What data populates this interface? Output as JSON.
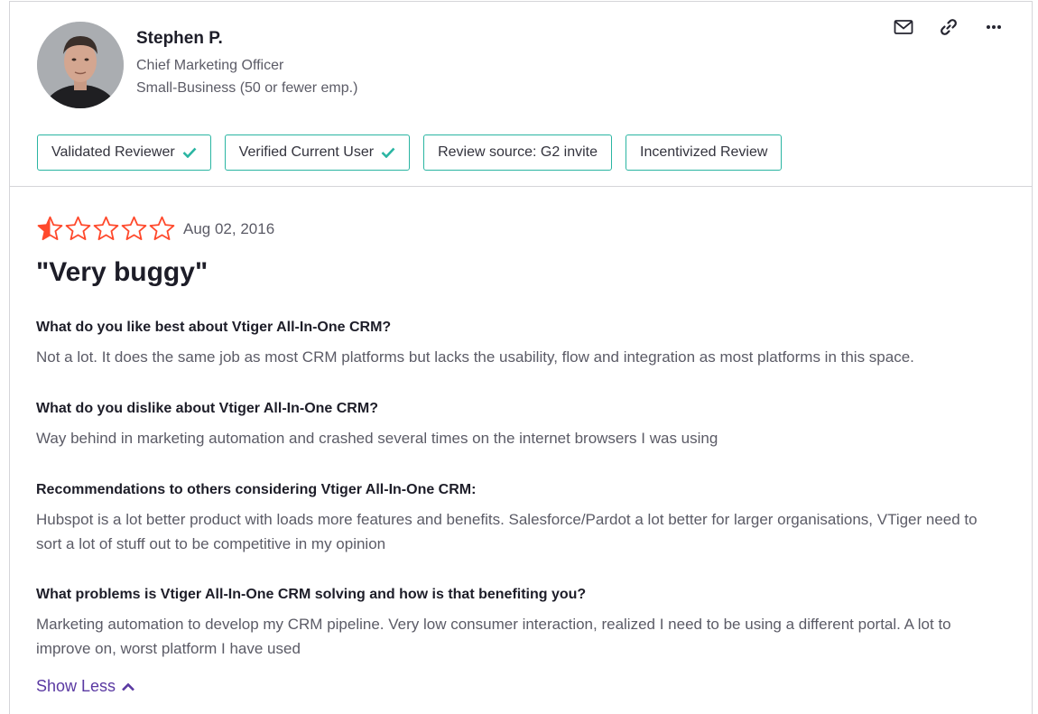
{
  "reviewer": {
    "name": "Stephen P.",
    "role": "Chief Marketing Officer",
    "company_size": "Small-Business (50 or fewer emp.)"
  },
  "actions": [
    {
      "icon": "mail-icon"
    },
    {
      "icon": "link-icon"
    },
    {
      "icon": "more-icon"
    }
  ],
  "badges": [
    {
      "label": "Validated Reviewer",
      "checked": true
    },
    {
      "label": "Verified Current User",
      "checked": true
    },
    {
      "label": "Review source: G2 invite",
      "checked": false
    },
    {
      "label": "Incentivized Review",
      "checked": false
    }
  ],
  "review": {
    "rating": 0.5,
    "rating_max": 5,
    "date": "Aug 02, 2016",
    "title": "\"Very buggy\"",
    "qa": [
      {
        "question": "What do you like best about Vtiger All-In-One CRM?",
        "answer": "Not a lot. It does the same job as most CRM platforms but lacks the usability, flow and integration as most platforms in this space."
      },
      {
        "question": "What do you dislike about Vtiger All-In-One CRM?",
        "answer": "Way behind in marketing automation and crashed several times on the internet browsers I was using"
      },
      {
        "question": "Recommendations to others considering Vtiger All-In-One CRM:",
        "answer": "Hubspot is a lot better product with loads more features and benefits. Salesforce/Pardot a lot better for larger organisations, VTiger need to sort a lot of stuff out to be competitive in my opinion"
      },
      {
        "question": "What problems is Vtiger All-In-One CRM solving and how is that benefiting you?",
        "answer": "Marketing automation to develop my CRM pipeline. Very low consumer interaction, realized I need to be using a different portal. A lot to improve on, worst platform I have used"
      }
    ],
    "show_less_label": "Show Less"
  },
  "colors": {
    "accent_teal": "#2ab5a2",
    "star_red": "#ff492c",
    "link_purple": "#5a39a2"
  }
}
